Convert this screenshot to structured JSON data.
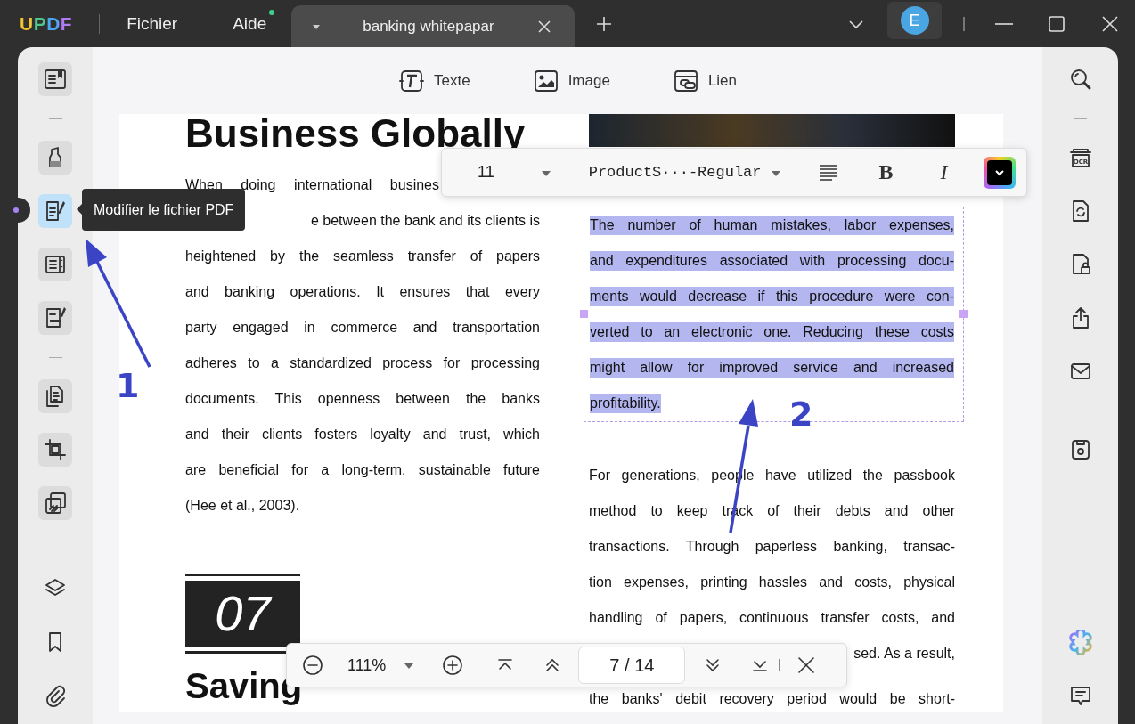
{
  "app": {
    "logo": "UPDF",
    "menus": [
      {
        "label": "Fichier",
        "badge": false
      },
      {
        "label": "Aide",
        "badge": true
      }
    ]
  },
  "tabs": [
    {
      "title": "banking whitepapar",
      "selected": true
    }
  ],
  "account": {
    "initial": "E"
  },
  "left_sidebar": {
    "groups": [
      [
        {
          "kind": "reader",
          "selected": false
        }
      ],
      [
        {
          "kind": "comment",
          "selected": false
        },
        {
          "kind": "edit",
          "selected": true
        },
        {
          "kind": "form",
          "selected": false
        },
        {
          "kind": "sign",
          "selected": false
        }
      ],
      [
        {
          "kind": "organize",
          "selected": false
        },
        {
          "kind": "crop",
          "selected": false
        },
        {
          "kind": "batch",
          "selected": false
        }
      ]
    ],
    "bottom": [
      {
        "kind": "layers"
      },
      {
        "kind": "bookmark"
      },
      {
        "kind": "attachment"
      }
    ]
  },
  "tooltip": {
    "text": "Modifier le fichier PDF"
  },
  "edit_toolbar": [
    {
      "label": "Texte",
      "kind": "text"
    },
    {
      "label": "Image",
      "kind": "image"
    },
    {
      "label": "Lien",
      "kind": "link"
    }
  ],
  "format_toolbar": {
    "font_size": "11",
    "font_name": "ProductS···-Regular",
    "bold_label": "B",
    "italic_label": "I"
  },
  "document": {
    "left_column": {
      "heading": "Business Globally",
      "lines": [
        {
          "text": "When doing international busines",
          "kind": "start"
        },
        {
          "text": "e between the bank and its clients is",
          "kind": "end"
        },
        {
          "text": "heightened by the seamless transfer of papers",
          "kind": "full"
        },
        {
          "text": "and banking operations. It ensures that every",
          "kind": "full"
        },
        {
          "text": "party engaged in commerce and transportation",
          "kind": "full"
        },
        {
          "text": "adheres to a standardized process for processing",
          "kind": "full"
        },
        {
          "text": "documents. This openness between the banks",
          "kind": "full"
        },
        {
          "text": "and their clients fosters loyalty and trust, which",
          "kind": "full"
        },
        {
          "text": "are beneficial for a long-term, sustainable future",
          "kind": "full"
        },
        {
          "text": "(Hee et al., 2003).",
          "kind": "start"
        }
      ],
      "section_number": "07",
      "subheading": "Saving"
    },
    "right_column": {
      "selected_block": {
        "selected": true,
        "lines": [
          {
            "text": "The number of human mistakes, labor expenses,",
            "kind": "full"
          },
          {
            "text": "and expenditures associated with processing docu-",
            "kind": "full"
          },
          {
            "text": "ments would decrease if this procedure were con-",
            "kind": "full"
          },
          {
            "text": "verted to an electronic one. Reducing these costs",
            "kind": "full"
          },
          {
            "text": "might allow for improved service and increased",
            "kind": "full"
          },
          {
            "text": "profitability.",
            "kind": "start"
          }
        ]
      },
      "lines": [
        {
          "text": "For generations, people have utilized the passbook",
          "kind": "full"
        },
        {
          "text": "method to keep track of their debts and other",
          "kind": "full"
        },
        {
          "text": "transactions. Through paperless banking, transac-",
          "kind": "full"
        },
        {
          "text": "tion expenses, printing hassles and costs, physical",
          "kind": "full"
        },
        {
          "text": "handling of papers, continuous transfer costs, and",
          "kind": "full"
        },
        {
          "text": "sed. As a result,",
          "kind": "end"
        },
        {
          "text": "the banks' debit recovery period would be short-",
          "kind": "full"
        }
      ]
    }
  },
  "zoom_bar": {
    "zoom": "111%",
    "page": "7 / 14"
  },
  "right_sidebar": {
    "groups": [
      [
        {
          "kind": "search"
        }
      ],
      [
        {
          "kind": "ocr",
          "label": "OCR"
        },
        {
          "kind": "convert"
        },
        {
          "kind": "protect"
        },
        {
          "kind": "share"
        },
        {
          "kind": "email"
        }
      ],
      [
        {
          "kind": "save"
        }
      ]
    ],
    "bottom": [
      {
        "kind": "ai"
      },
      {
        "kind": "chat"
      }
    ]
  },
  "annotations": [
    {
      "label": "1"
    },
    {
      "label": "2"
    }
  ]
}
